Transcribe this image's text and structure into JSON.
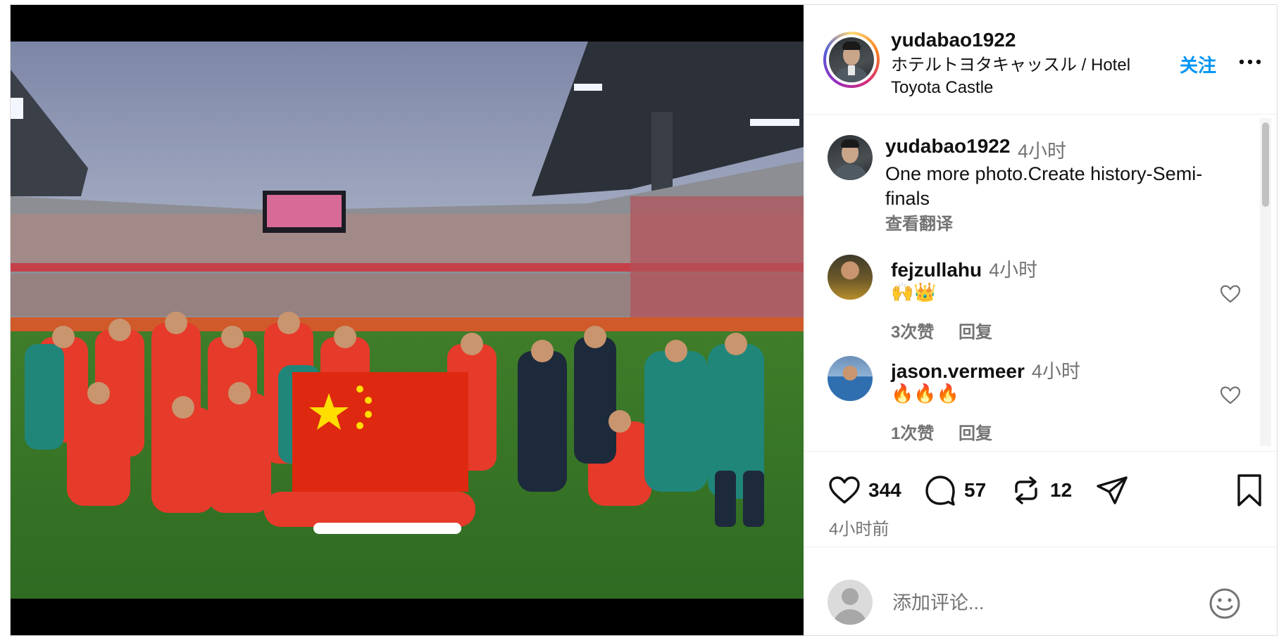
{
  "post": {
    "username": "yudabao1922",
    "location": "ホテルトヨタキャッスル / Hotel Toyota Castle",
    "follow_label": "关注"
  },
  "caption": {
    "username": "yudabao1922",
    "time": "4小时",
    "text": "One more photo.Create history-Semi-finals",
    "translate_label": "查看翻译"
  },
  "comments": [
    {
      "username": "fejzullahu",
      "time": "4小时",
      "text": "🙌👑",
      "likes_label": "3次赞",
      "reply_label": "回复"
    },
    {
      "username": "jason.vermeer",
      "time": "4小时",
      "text": "🔥🔥🔥",
      "likes_label": "1次赞",
      "reply_label": "回复"
    }
  ],
  "actions": {
    "likes": "344",
    "comments": "57",
    "reposts": "12"
  },
  "post_time": "4小时前",
  "composer": {
    "placeholder": "添加评论..."
  },
  "colors": {
    "accent": "#0095f6",
    "muted": "#737373",
    "border": "#dbdbdb"
  }
}
